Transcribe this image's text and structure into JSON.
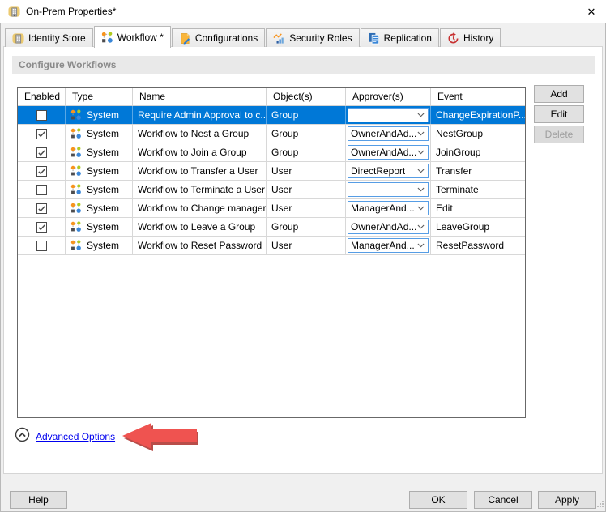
{
  "window": {
    "title": "On-Prem Properties*",
    "close_label": "✕"
  },
  "tabs": [
    {
      "label": "Identity Store",
      "selected": false
    },
    {
      "label": "Workflow *",
      "selected": true
    },
    {
      "label": "Configurations",
      "selected": false
    },
    {
      "label": "Security Roles",
      "selected": false
    },
    {
      "label": "Replication",
      "selected": false
    },
    {
      "label": "History",
      "selected": false
    }
  ],
  "section": {
    "title": "Configure Workflows"
  },
  "table": {
    "columns": [
      "Enabled",
      "Type",
      "Name",
      "Object(s)",
      "Approver(s)",
      "Event"
    ],
    "rows": [
      {
        "enabled": false,
        "selected": true,
        "type": "System",
        "name": "Require Admin Approval to c...",
        "object": "Group",
        "approver": "",
        "event": "ChangeExpirationP..."
      },
      {
        "enabled": true,
        "selected": false,
        "type": "System",
        "name": "Workflow to Nest a Group",
        "object": "Group",
        "approver": "OwnerAndAd...",
        "event": "NestGroup"
      },
      {
        "enabled": true,
        "selected": false,
        "type": "System",
        "name": "Workflow to Join a Group",
        "object": "Group",
        "approver": "OwnerAndAd...",
        "event": "JoinGroup"
      },
      {
        "enabled": true,
        "selected": false,
        "type": "System",
        "name": "Workflow to Transfer a User",
        "object": "User",
        "approver": "DirectReport",
        "event": "Transfer"
      },
      {
        "enabled": false,
        "selected": false,
        "type": "System",
        "name": "Workflow to Terminate a User",
        "object": "User",
        "approver": "",
        "event": "Terminate"
      },
      {
        "enabled": true,
        "selected": false,
        "type": "System",
        "name": "Workflow to Change manager",
        "object": "User",
        "approver": "ManagerAnd...",
        "event": "Edit"
      },
      {
        "enabled": true,
        "selected": false,
        "type": "System",
        "name": "Workflow to Leave a Group",
        "object": "Group",
        "approver": "OwnerAndAd...",
        "event": "LeaveGroup"
      },
      {
        "enabled": false,
        "selected": false,
        "type": "System",
        "name": "Workflow to Reset Password",
        "object": "User",
        "approver": "ManagerAnd...",
        "event": "ResetPassword"
      }
    ]
  },
  "actions": {
    "add": "Add",
    "edit": "Edit",
    "delete": "Delete"
  },
  "advanced": {
    "label": "Advanced Options"
  },
  "footer": {
    "help": "Help",
    "ok": "OK",
    "cancel": "Cancel",
    "apply": "Apply"
  },
  "colors": {
    "selection": "#0078D7",
    "link": "#0000EE",
    "arrow": "#EF5350",
    "arrow_shadow": "#B03A35"
  }
}
